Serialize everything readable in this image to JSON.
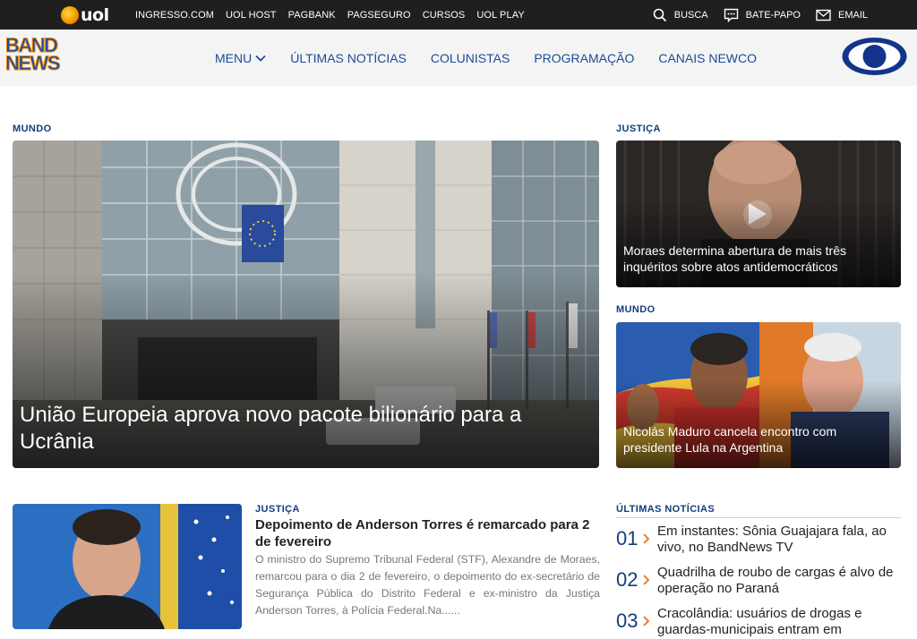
{
  "uol": {
    "logo_text": "uol",
    "links": [
      "INGRESSO.COM",
      "UOL HOST",
      "PAGBANK",
      "PAGSEGURO",
      "CURSOS",
      "UOL PLAY"
    ],
    "tools": {
      "search": "BUSCA",
      "chat": "BATE-PAPO",
      "email": "EMAIL"
    }
  },
  "band": {
    "logo_line1": "BAND",
    "logo_line2": "NEWS",
    "nav": {
      "menu": "MENU",
      "latest": "ÚLTIMAS NOTÍCIAS",
      "columnists": "COLUNISTAS",
      "programming": "PROGRAMAÇÃO",
      "channels": "CANAIS NEWCO"
    }
  },
  "main_story": {
    "category": "MUNDO",
    "headline": "União Europeia aprova novo pacote bilionário para a Ucrânia"
  },
  "side_story_1": {
    "category": "JUSTIÇA",
    "headline": "Moraes determina abertura de mais três inquéritos sobre atos antidemocráticos"
  },
  "side_story_2": {
    "category": "MUNDO",
    "headline": "Nicolás Maduro cancela encontro com presidente Lula na Argentina"
  },
  "torres_story": {
    "category": "JUSTIÇA",
    "headline": "Depoimento de Anderson Torres é remarcado para 2 de fevereiro",
    "summary": "O ministro do Supremo Tribunal Federal (STF), Alexandre de Moraes, remarcou para o dia 2 de fevereiro, o depoimento do ex-secretário de Segurança Pública do Distrito Federal e ex-ministro da Justiça Anderson Torres, à Polícia Federal.Na......"
  },
  "ultimas": {
    "title": "ÚLTIMAS NOTÍCIAS",
    "items": [
      {
        "num": "01",
        "text": "Em instantes: Sônia Guajajara fala, ao vivo, no BandNews TV"
      },
      {
        "num": "02",
        "text": "Quadrilha de roubo de cargas é alvo de operação no Paraná"
      },
      {
        "num": "03",
        "text": "Cracolândia: usuários de drogas e guardas-municipais entram em"
      }
    ]
  },
  "colors": {
    "accent_blue": "#123e7c",
    "nav_blue": "#1c4b96",
    "topbar": "#1f1f1f",
    "arrow_orange": "#e8731a"
  }
}
